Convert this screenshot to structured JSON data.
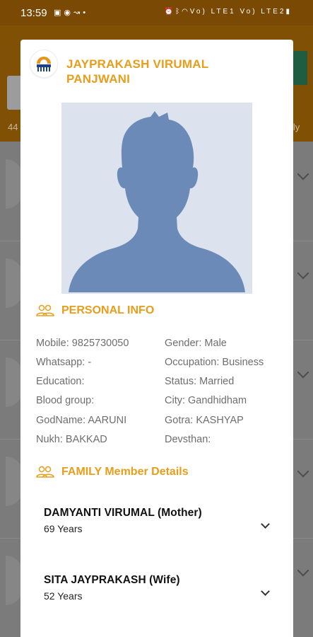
{
  "status_bar": {
    "time": "13:59",
    "left_icons": [
      "gallery-icon",
      "whatsapp-icon",
      "missed-call-icon",
      "dot-icon"
    ],
    "right_icons": [
      "alarm-icon",
      "bluetooth-icon",
      "wifi-icon",
      "volte-signal-icon",
      "lte-signal-icon",
      "battery-icon"
    ],
    "right_text": "Vo) LTE1 Vo) LTE2"
  },
  "background": {
    "count_text": "44",
    "right_text": "ily",
    "header_color": "#805104"
  },
  "dialog": {
    "name_line1": "JAYPRAKASH VIRUMAL",
    "name_line2": "PANJWANI",
    "personal_info": {
      "title": "PERSONAL INFO",
      "left": [
        "Mobile: 9825730050",
        "Whatsapp: -",
        "Education:",
        "Blood group:",
        "GodName: AARUNI",
        "Nukh: BAKKAD"
      ],
      "right": [
        "Gender: Male",
        "Occupation: Business",
        "Status: Married",
        "City: Gandhidham",
        "Gotra: KASHYAP",
        "Devsthan:"
      ]
    },
    "family": {
      "title": "FAMILY Member Details",
      "members": [
        {
          "name": "DAMYANTI VIRUMAL  (Mother)",
          "age": "69 Years"
        },
        {
          "name": "SITA JAYPRAKASH  (Wife)",
          "age": "52 Years"
        }
      ]
    }
  },
  "colors": {
    "accent": "#e89d1b",
    "silhouette": "#6b8ab8",
    "photo_bg": "#dde3ee"
  }
}
